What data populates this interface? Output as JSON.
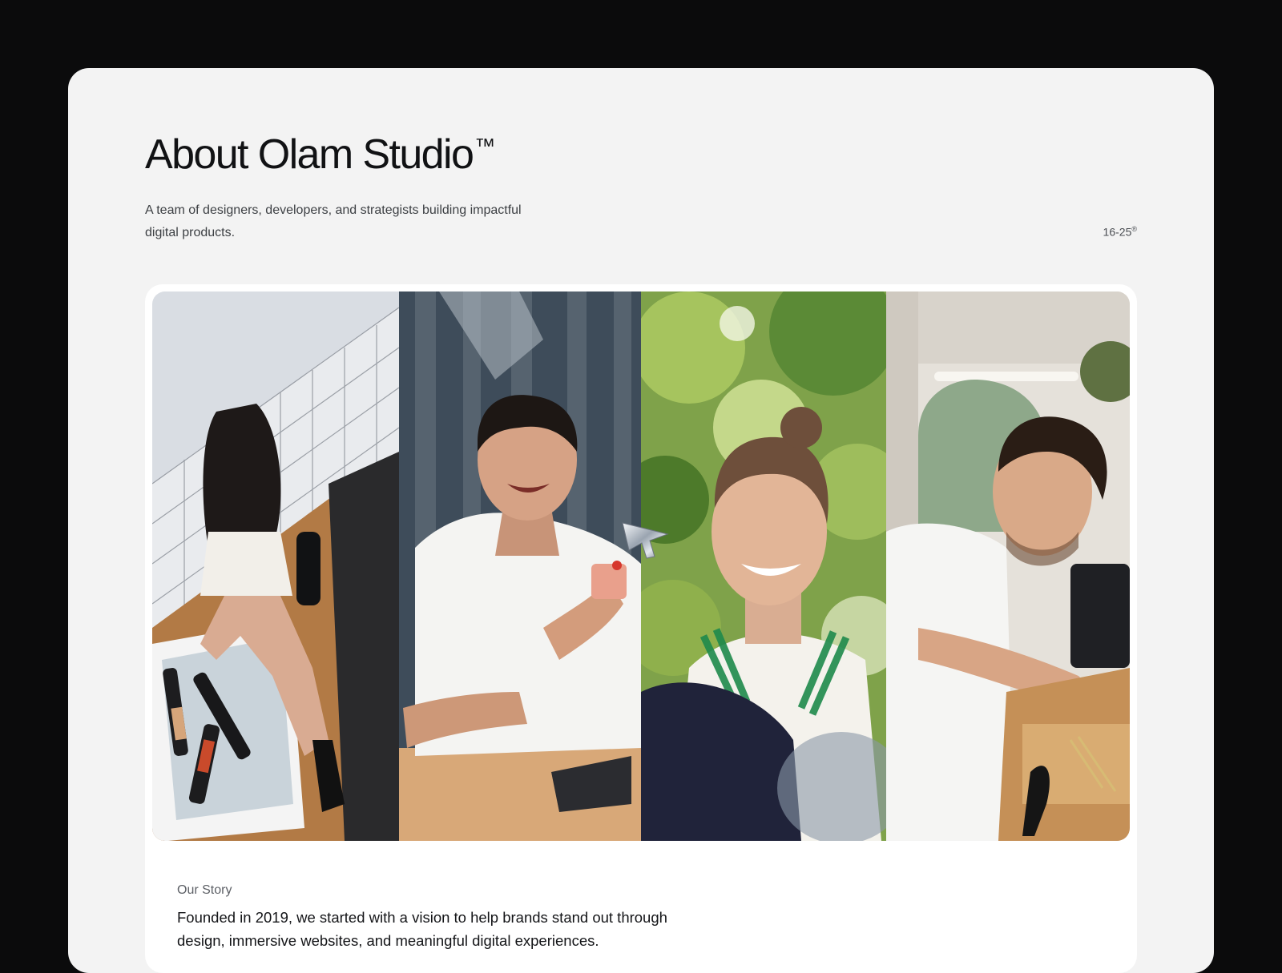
{
  "header": {
    "title": "About Olam Studio",
    "trademark": "™",
    "subtitle": "A team of designers, developers, and strategists building impactful digital products.",
    "range": "16-25",
    "range_mark": "®"
  },
  "gallery": {
    "photos": [
      {
        "icon": "woman-with-wine-bottles-photo"
      },
      {
        "icon": "smiling-man-photo"
      },
      {
        "icon": "smiling-woman-photo"
      },
      {
        "icon": "man-preparing-food-photo"
      }
    ],
    "cursor_icon": "chrome-cursor-icon"
  },
  "story": {
    "label": "Our Story",
    "text": "Founded in 2019, we started with a vision to help brands stand out through design, immersive websites, and meaningful digital experiences."
  }
}
